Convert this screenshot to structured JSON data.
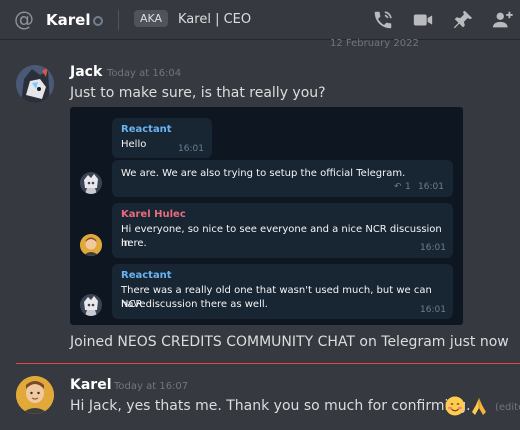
{
  "header": {
    "at_icon": "at-icon",
    "channel_name": "Karel",
    "status": "offline",
    "aka_label": "AKA",
    "nickname": "Karel | CEO",
    "icons": [
      "call-icon",
      "video-icon",
      "pin-icon",
      "add-member-icon"
    ]
  },
  "date_fragment": "12 February 2022",
  "messages": [
    {
      "author": "Jack",
      "timestamp": "Today at 16:04",
      "text": "Just to make sure, is that really you?",
      "followup": "Joined NEOS CREDITS COMMUNITY CHAT on Telegram just now"
    },
    {
      "author": "Karel",
      "timestamp": "Today at 16:07",
      "text": "Hi Jack, yes thats me. Thank you so much for confirming.",
      "edited_fragment": "(edite"
    }
  ],
  "embed": {
    "bubbles": [
      {
        "name": "Reactant",
        "text": "Hello",
        "time": "16:01"
      },
      {
        "name": "",
        "text": "We are. We are also trying to setup the official Telegram.",
        "reply_count": "1",
        "time": "16:01"
      },
      {
        "name": "Karel Hulec",
        "text_line1": "Hi everyone, so nice to see everyone and a nice NCR discussion in",
        "text_line2": "here.",
        "time": "16:01"
      },
      {
        "name": "Reactant",
        "text_line1": "There was a really old one that wasn't used much, but we can have",
        "text_line2": "NCR discussion there as well.",
        "time": "16:01"
      }
    ]
  },
  "colors": {
    "background": "#36393f",
    "telegram_bg": "#0e1621",
    "bubble": "#182533",
    "reactant_name": "#6ab3f3",
    "karel_name": "#e96c7c",
    "new_divider": "#ed4245"
  }
}
